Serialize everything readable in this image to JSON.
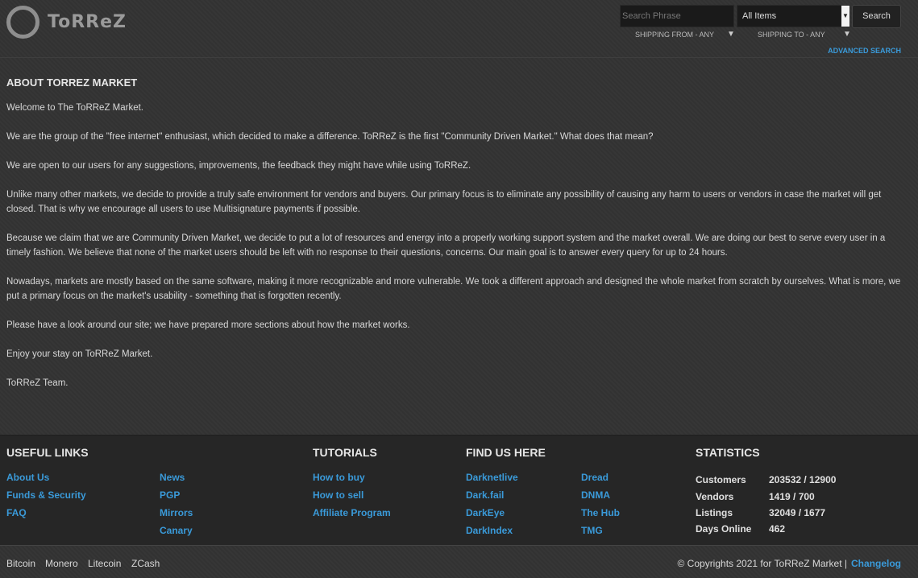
{
  "header": {
    "logo_text": "ToRReZ",
    "search_placeholder": "Search Phrase",
    "category_selected": "All Items",
    "search_button": "Search",
    "shipping_from": "SHIPPING FROM - ANY",
    "shipping_to": "SHIPPING TO - ANY",
    "dropdown_glyph": "▼",
    "advanced_search": "ADVANCED SEARCH"
  },
  "about": {
    "title": "ABOUT TORREZ MARKET",
    "paragraphs": [
      "Welcome to The ToRReZ Market.",
      "We are the group of the \"free internet\" enthusiast, which decided to make a difference. ToRReZ is the first \"Community Driven Market.\" What does that mean?",
      "We are open to our users for any suggestions, improvements, the feedback they might have while using ToRReZ.",
      "Unlike many other markets, we decide to provide a truly safe environment for vendors and buyers. Our primary focus is to eliminate any possibility of causing any harm to users or vendors in case the market will get closed. That is why we encourage all users to use Multisignature payments if possible.",
      "Because we claim that we are Community Driven Market, we decide to put a lot of resources and energy into a properly working support system and the market overall. We are doing our best to serve every user in a timely fashion. We believe that none of the market users should be left with no response to their questions, concerns. Our main goal is to answer every query for up to 24 hours.",
      "Nowadays, markets are mostly based on the same software, making it more recognizable and more vulnerable. We took a different approach and designed the whole market from scratch by ourselves. What is more, we put a primary focus on the market's usability - something that is forgotten recently.",
      "Please have a look around our site; we have prepared more sections about how the market works.",
      "Enjoy your stay on ToRReZ Market.",
      "ToRReZ Team."
    ]
  },
  "footer": {
    "useful_links": {
      "title": "USEFUL LINKS",
      "col1": [
        "About Us",
        "Funds & Security",
        "FAQ"
      ],
      "col2": [
        "News",
        "PGP",
        "Mirrors",
        "Canary"
      ]
    },
    "tutorials": {
      "title": "TUTORIALS",
      "links": [
        "How to buy",
        "How to sell",
        "Affiliate Program"
      ]
    },
    "find_us": {
      "title": "FIND US HERE",
      "col1": [
        "Darknetlive",
        "Dark.fail",
        "DarkEye",
        "DarkIndex"
      ],
      "col2": [
        "Dread",
        "DNMA",
        "The Hub",
        "TMG"
      ]
    },
    "statistics": {
      "title": "STATISTICS",
      "rows": [
        {
          "label": "Customers",
          "value": "203532 / 12900"
        },
        {
          "label": "Vendors",
          "value": "1419 / 700"
        },
        {
          "label": "Listings",
          "value": "32049 / 1677"
        },
        {
          "label": "Days Online",
          "value": "462"
        }
      ]
    }
  },
  "bottom": {
    "coins": [
      "Bitcoin",
      "Monero",
      "Litecoin",
      "ZCash"
    ],
    "copyright": "© Copyrights 2021 for ToRReZ Market |",
    "changelog": "Changelog"
  },
  "colors": {
    "accent": "#3a9ad9",
    "background": "#333333",
    "footer_background": "#262626"
  }
}
